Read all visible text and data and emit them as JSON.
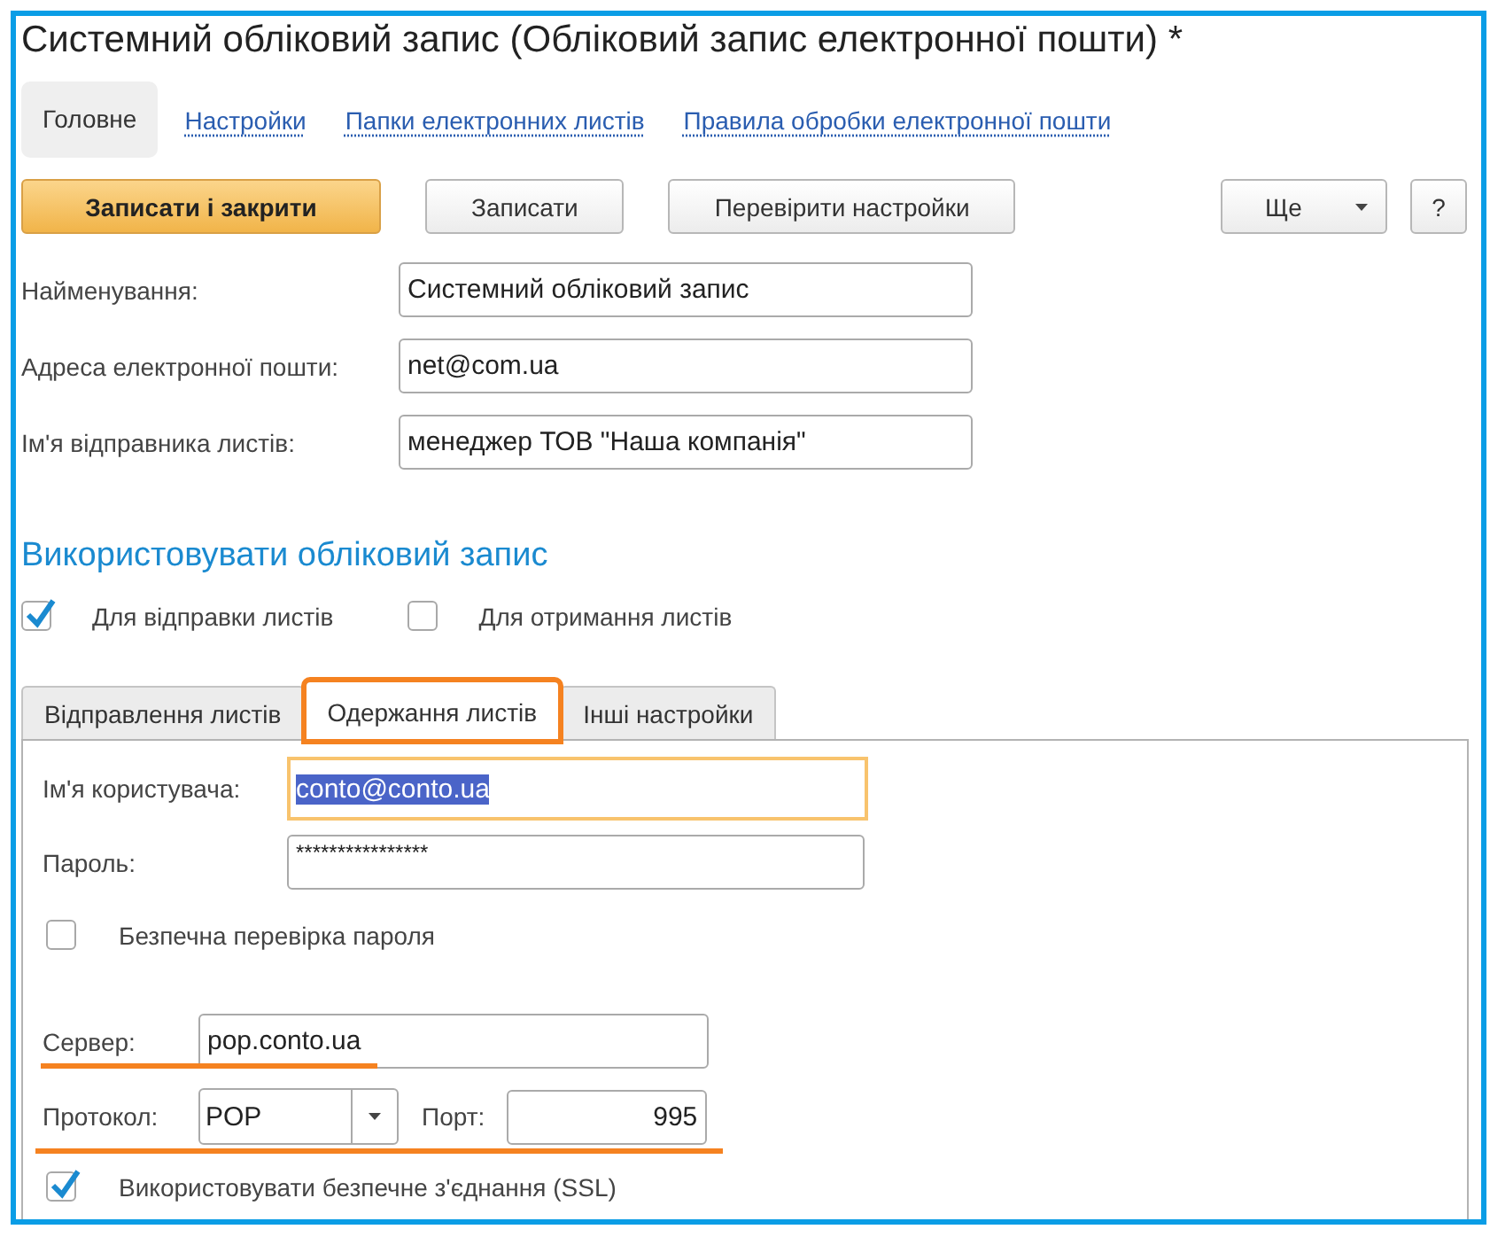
{
  "window": {
    "title": "Системний обліковий запис (Обліковий запис електронної пошти) *"
  },
  "nav": [
    {
      "label": "Головне",
      "selected": true
    },
    {
      "label": "Настройки",
      "selected": false
    },
    {
      "label": "Папки електронних листів",
      "selected": false
    },
    {
      "label": "Правила обробки електронної пошти",
      "selected": false
    }
  ],
  "toolbar": [
    {
      "label": "Записати і закрити",
      "kind": "primary"
    },
    {
      "label": "Записати",
      "kind": "normal"
    },
    {
      "label": "Перевірити настройки",
      "kind": "normal"
    },
    {
      "label": "Ще",
      "kind": "menu"
    },
    {
      "label": "?",
      "kind": "help"
    }
  ],
  "fields": [
    {
      "label": "Найменування:",
      "value": "Системний обліковий запис"
    },
    {
      "label": "Адреса електронної пошти:",
      "value": "net@com.ua"
    },
    {
      "label": "Ім'я відправника листів:",
      "value": "менеджер ТОВ \"Наша компанія\""
    }
  ],
  "use_account": {
    "title": "Використовувати обліковий запис",
    "options": [
      {
        "label": "Для відправки листів",
        "checked": true
      },
      {
        "label": "Для отримання листів",
        "checked": false
      }
    ]
  },
  "tabs": [
    {
      "label": "Відправлення листів",
      "selected": false,
      "highlighted": false
    },
    {
      "label": "Одержання листів",
      "selected": true,
      "highlighted": true
    },
    {
      "label": "Інші настройки",
      "selected": false,
      "highlighted": false
    }
  ],
  "receiving": {
    "username": {
      "label": "Ім'я користувача:",
      "value": "conto@conto.ua",
      "focused": true,
      "text_selected": true
    },
    "password": {
      "label": "Пароль:",
      "value": "****************"
    },
    "secure_password": {
      "label": "Безпечна перевірка пароля",
      "checked": false
    },
    "server": {
      "label": "Сервер:",
      "value": "pop.conto.ua",
      "underlined": true
    },
    "protocol": {
      "label": "Протокол:",
      "value": "POP",
      "underlined": true
    },
    "port": {
      "label": "Порт:",
      "value": "995"
    },
    "ssl": {
      "label": "Використовувати безпечне з'єднання (SSL)",
      "checked": true
    }
  }
}
